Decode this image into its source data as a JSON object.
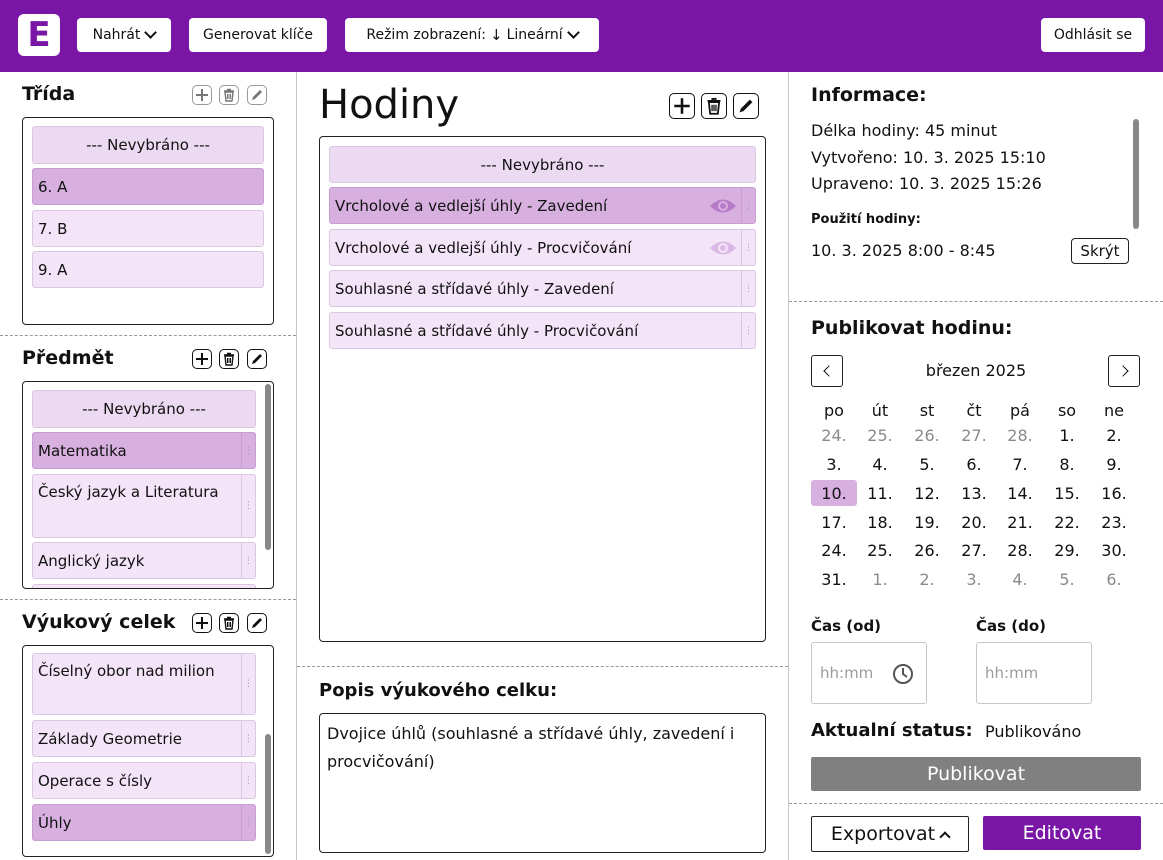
{
  "app": {
    "logo_letter": "E"
  },
  "topbar": {
    "upload_label": "Nahrát",
    "generate_keys_label": "Generovat klíče",
    "view_mode_prefix": "Režim zobrazení:",
    "view_mode_arrow": "↓",
    "view_mode_value": "Lineární",
    "logout_label": "Odhlásit se",
    "accent_color": "#7a16a6"
  },
  "trida": {
    "title": "Třída",
    "items": [
      "--- Nevybráno ---",
      "6. A",
      "7. B",
      "9. A"
    ]
  },
  "predmet": {
    "title": "Předmět",
    "items": [
      "--- Nevybráno ---",
      "Matematika",
      "Český jazyk a Literatura",
      "Anglický jazyk"
    ]
  },
  "celek": {
    "title": "Výukový celek",
    "items": [
      "Číselný obor nad milion",
      "Základy Geometrie",
      "Operace s čísly",
      "Úhly"
    ]
  },
  "hodiny": {
    "title": "Hodiny",
    "items": [
      "--- Nevybráno ---",
      "Vrcholové a vedlejší úhly - Zavedení",
      "Vrcholové a vedlejší úhly - Procvičování",
      "Souhlasné a střídavé úhly - Zavedení",
      "Souhlasné a střídavé úhly - Procvičování"
    ]
  },
  "popis": {
    "title": "Popis výukového celku:",
    "text": "Dvojice úhlů (souhlasné a střídavé úhly, zavedení i procvičování)"
  },
  "info": {
    "title": "Informace:",
    "length": "Délka hodiny: 45 minut",
    "created": "Vytvořeno: 10. 3. 2025 15:10",
    "updated": "Upraveno: 10. 3. 2025 15:26",
    "usage_title": "Použití hodiny:",
    "usage_value": "10. 3. 2025 8:00 - 8:45",
    "hide_label": "Skrýt"
  },
  "publish": {
    "title": "Publikovat hodinu:",
    "month": "březen 2025",
    "weekdays": [
      "po",
      "út",
      "st",
      "čt",
      "pá",
      "so",
      "ne"
    ],
    "weeks": [
      [
        "24.",
        "25.",
        "26.",
        "27.",
        "28.",
        "1.",
        "2."
      ],
      [
        "3.",
        "4.",
        "5.",
        "6.",
        "7.",
        "8.",
        "9."
      ],
      [
        "10.",
        "11.",
        "12.",
        "13.",
        "14.",
        "15.",
        "16."
      ],
      [
        "17.",
        "18.",
        "19.",
        "20.",
        "21.",
        "22.",
        "23."
      ],
      [
        "24.",
        "25.",
        "26.",
        "27.",
        "28.",
        "29.",
        "30."
      ],
      [
        "31.",
        "1.",
        "2.",
        "3.",
        "4.",
        "5.",
        "6."
      ]
    ],
    "selected_day": "10.",
    "time_from_label": "Čas (od)",
    "time_to_label": "Čas (do)",
    "time_placeholder": "hh:mm",
    "status_label": "Aktualní status:",
    "status_value": "Publikováno",
    "publish_label": "Publikovat"
  },
  "footer": {
    "export_label": "Exportovat",
    "edit_label": "Editovat"
  }
}
